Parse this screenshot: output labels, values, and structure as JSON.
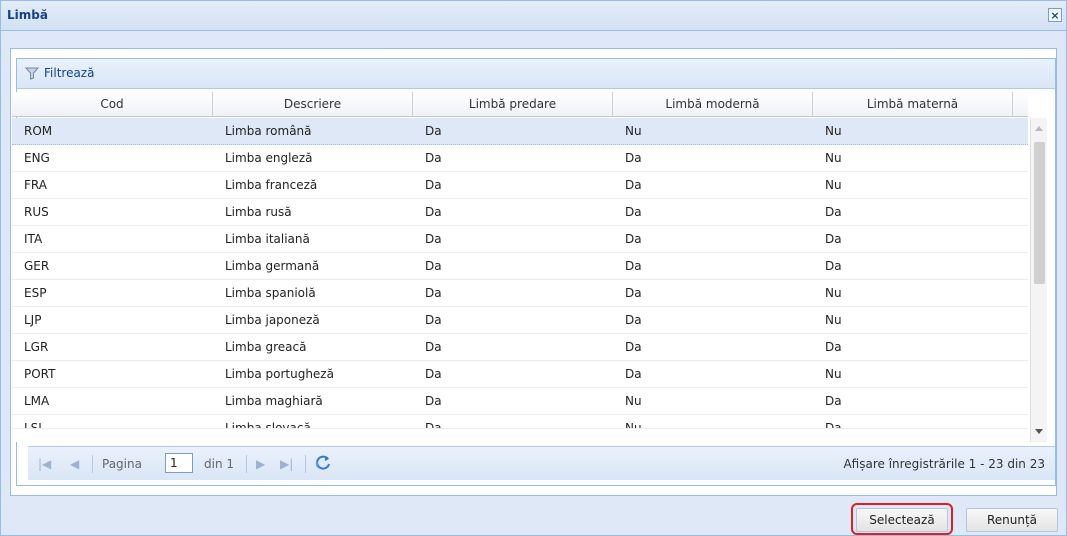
{
  "window": {
    "title": "Limbă",
    "close_label": "×"
  },
  "toolbar": {
    "filter_label": "Filtrează"
  },
  "columns": [
    "Cod",
    "Descriere",
    "Limbă predare",
    "Limbă modernă",
    "Limbă maternă"
  ],
  "rows": [
    [
      "ROM",
      "Limba română",
      "Da",
      "Nu",
      "Nu"
    ],
    [
      "ENG",
      "Limba engleză",
      "Da",
      "Da",
      "Nu"
    ],
    [
      "FRA",
      "Limba franceză",
      "Da",
      "Da",
      "Nu"
    ],
    [
      "RUS",
      "Limba rusă",
      "Da",
      "Da",
      "Da"
    ],
    [
      "ITA",
      "Limba italiană",
      "Da",
      "Da",
      "Da"
    ],
    [
      "GER",
      "Limba germană",
      "Da",
      "Da",
      "Da"
    ],
    [
      "ESP",
      "Limba spaniolă",
      "Da",
      "Da",
      "Nu"
    ],
    [
      "LJP",
      "Limba japoneză",
      "Da",
      "Da",
      "Nu"
    ],
    [
      "LGR",
      "Limba greacă",
      "Da",
      "Da",
      "Da"
    ],
    [
      "PORT",
      "Limba portugheză",
      "Da",
      "Da",
      "Nu"
    ],
    [
      "LMA",
      "Limba maghiară",
      "Da",
      "Nu",
      "Da"
    ],
    [
      "LSL",
      "Limba slovacă",
      "Da",
      "Nu",
      "Da"
    ]
  ],
  "selected_row": 0,
  "paging": {
    "page_label": "Pagina",
    "page_value": "1",
    "of_label": "din 1",
    "info": "Afișare înregistrările 1 - 23 din 23"
  },
  "buttons": {
    "select": "Selectează",
    "cancel": "Renunță"
  },
  "colors": {
    "title": "#15428b",
    "border": "#99bbe8",
    "selected_row": "#dfe8f6",
    "highlight": "#e02020"
  }
}
